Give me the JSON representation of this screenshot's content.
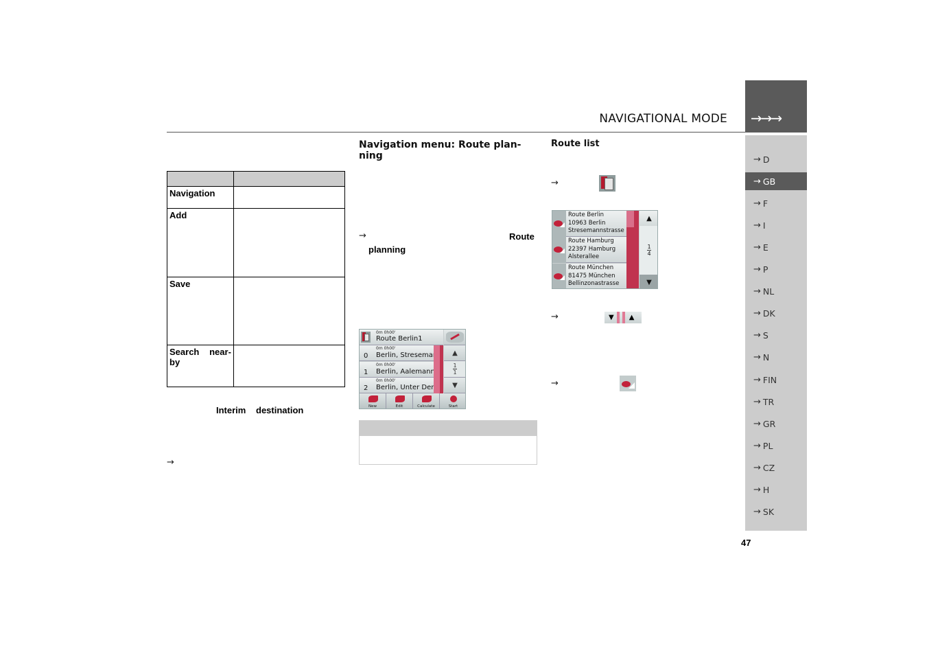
{
  "header": {
    "title": "NAVIGATIONAL MODE",
    "tab_arrows": "→→→"
  },
  "sidebar": {
    "items": [
      {
        "label": "D"
      },
      {
        "label": "GB",
        "active": true
      },
      {
        "label": "F"
      },
      {
        "label": "I"
      },
      {
        "label": "E"
      },
      {
        "label": "P"
      },
      {
        "label": "NL"
      },
      {
        "label": "DK"
      },
      {
        "label": "S"
      },
      {
        "label": "N"
      },
      {
        "label": "FIN"
      },
      {
        "label": "TR"
      },
      {
        "label": "GR"
      },
      {
        "label": "PL"
      },
      {
        "label": "CZ"
      },
      {
        "label": "H"
      },
      {
        "label": "SK"
      }
    ],
    "arrow": "→"
  },
  "page_number": "47",
  "left_column": {
    "table": {
      "rows": [
        {
          "function": "Navigation",
          "description": ""
        },
        {
          "function": "Add",
          "description": ""
        },
        {
          "function": "Save",
          "description": ""
        },
        {
          "function_part1": "Search",
          "function_part2": "near-",
          "function_part3": "by",
          "description": ""
        }
      ]
    },
    "interim_word1": "Interim",
    "interim_word2": "destination",
    "arrow": "→"
  },
  "middle_column": {
    "heading_line1": "Navigation menu: Route plan-",
    "heading_line2": "ning",
    "arrow": "→",
    "route_label": "Route",
    "planning_label": "planning",
    "screen": {
      "header_time": "0m 0h00'",
      "header_title": "Route  Berlin1",
      "rows": [
        {
          "index": "0",
          "time": "0m 0h00'",
          "name": "Berlin, Stresemann."
        },
        {
          "index": "1",
          "time": "0m 0h00'",
          "name": "Berlin, Aalemannuf."
        },
        {
          "index": "2",
          "time": "0m 0h00'",
          "name": "Berlin, Unter Den L."
        }
      ],
      "page_current": "1",
      "page_total": "1",
      "up": "▲",
      "down": "▼",
      "toolbar": [
        "New",
        "Edit",
        "Calculate",
        "Start"
      ]
    }
  },
  "right_column": {
    "heading": "Route list",
    "arrow": "→",
    "routes": [
      {
        "line1": "Route  Berlin",
        "line2": "10963 Berlin",
        "line3": "Stresemannstrasse"
      },
      {
        "line1": "Route Hamburg",
        "line2": "22397 Hamburg",
        "line3": "Alsterallee"
      },
      {
        "line1": "Route München",
        "line2": "81475 München",
        "line3": "Bellinzonastrasse"
      }
    ],
    "page_current": "1",
    "page_total": "4",
    "up": "▲",
    "down": "▼"
  }
}
